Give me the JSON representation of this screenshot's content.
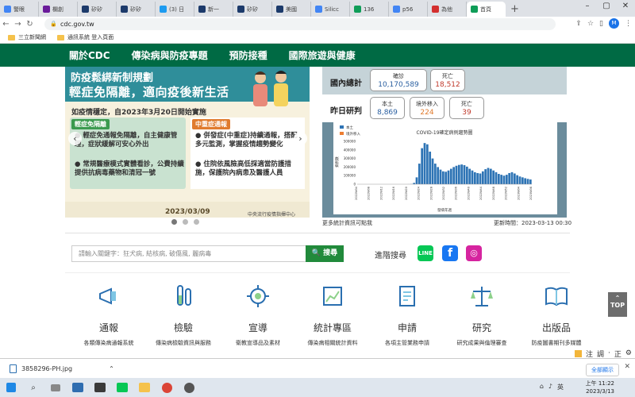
{
  "browser": {
    "tabs": [
      {
        "label": "警眼",
        "color": "#4285f4"
      },
      {
        "label": "欄創",
        "color": "#6a1b9a"
      },
      {
        "label": "矽矽",
        "color": "#1c3a6b"
      },
      {
        "label": "矽矽",
        "color": "#1c3a6b"
      },
      {
        "label": "(3) 日",
        "color": "#1d9bf0"
      },
      {
        "label": "新一",
        "color": "#1c3a6b"
      },
      {
        "label": "矽矽",
        "color": "#1c3a6b"
      },
      {
        "label": "美國",
        "color": "#1c3a6b"
      },
      {
        "label": "Silicc",
        "color": "#4285f4"
      },
      {
        "label": "136",
        "color": "#0f9d58"
      },
      {
        "label": "p56",
        "color": "#4285f4"
      },
      {
        "label": "為他",
        "color": "#d32f2f"
      },
      {
        "label": "首頁",
        "color": "#0f9d58"
      }
    ],
    "url": "cdc.gov.tw",
    "bookmarks": [
      "三立新聞網",
      "通訊系統 登入頁面"
    ],
    "avatar_letter": "M"
  },
  "nav": {
    "items": [
      "關於CDC",
      "傳染病與防疫專題",
      "預防接種",
      "國際旅遊與健康"
    ]
  },
  "banner": {
    "title1": "防疫鬆綁新制規劃",
    "title2": "輕症免隔離，適向疫後新生活",
    "subtitle": "如疫情穩定，自2023年3月20日開始實施",
    "left_header": "輕症免隔離",
    "left_items": [
      "輕症免通報免隔離，自主健康管理，症狀緩解可安心外出",
      "常規醫療模式實體看診，公費持續提供抗病毒藥物和清冠一號"
    ],
    "right_header": "中重症通報",
    "right_items": [
      "併發症(中重症)持續通報，搭配多元監測，掌握疫情趨勢變化",
      "住院依風險高低採適當防護措施，保護院內病患及醫護人員"
    ],
    "date": "2023/03/09",
    "org": "中央流行疫情指揮中心"
  },
  "stats": {
    "domestic_label": "國內總計",
    "yesterday_label": "昨日研判",
    "confirmed_label": "確診",
    "confirmed_value": "10,170,589",
    "death_label": "死亡",
    "death_value": "18,512",
    "local_label": "本土",
    "local_value": "8,869",
    "imported_label": "境外移入",
    "imported_value": "224",
    "daily_death_label": "死亡",
    "daily_death_value": "39",
    "more_note": "更多統計資訊可點我",
    "update_time": "更新時間：2023-03-13 00:30"
  },
  "chart_data": {
    "type": "bar",
    "title": "COVID-19確定病例趨勢圖",
    "legend": [
      "本土",
      "境外移入"
    ],
    "ylabel": "病例數",
    "xlabel": "發病年週",
    "ylim": [
      0,
      500000
    ],
    "yticks": [
      "500000",
      "400000",
      "300000",
      "200000",
      "100000",
      "0"
    ],
    "xticks": [
      "2022W04",
      "2022W08",
      "2022W12",
      "2022W16",
      "2022W20",
      "2022W24",
      "2022W28",
      "2022W32",
      "2022W36",
      "2022W40",
      "2022W44",
      "2022W48",
      "2022W52",
      "2023W04",
      "2023W08"
    ],
    "values": [
      0,
      0,
      0,
      0,
      0,
      0,
      0,
      0,
      0,
      0,
      0,
      0,
      0,
      0,
      0,
      0,
      0,
      0,
      0,
      500,
      2000,
      15000,
      80000,
      240000,
      420000,
      480000,
      465000,
      380000,
      300000,
      240000,
      200000,
      170000,
      150000,
      145000,
      160000,
      180000,
      200000,
      215000,
      225000,
      230000,
      222000,
      205000,
      180000,
      160000,
      140000,
      130000,
      125000,
      150000,
      175000,
      190000,
      180000,
      160000,
      140000,
      120000,
      110000,
      100000,
      110000,
      130000,
      140000,
      125000,
      105000,
      90000,
      80000,
      70000,
      62000,
      55000
    ],
    "colors": {
      "local": "#2e74b5",
      "imported": "#ed7d31"
    }
  },
  "search": {
    "placeholder": "請輸入關鍵字：狂犬病, 結核病, 破傷風, 麗病毒",
    "button": "搜尋",
    "advanced": "進階搜尋"
  },
  "icons": [
    {
      "title": "通報",
      "sub": "各類傳染病通報系統",
      "icon": "megaphone-icon"
    },
    {
      "title": "檢驗",
      "sub": "傳染病檢驗資訊與服務",
      "icon": "test-tube-icon"
    },
    {
      "title": "宣導",
      "sub": "衛教宣導品及素材",
      "icon": "microbe-icon"
    },
    {
      "title": "統計專區",
      "sub": "傳染病相關統計資料",
      "icon": "statistics-icon"
    },
    {
      "title": "申請",
      "sub": "各項主管業務申請",
      "icon": "application-icon"
    },
    {
      "title": "研究",
      "sub": "研究成果與倫理審查",
      "icon": "scale-icon"
    },
    {
      "title": "出版品",
      "sub": "防疫圖書期刊多媒體",
      "icon": "book-icon"
    }
  ],
  "top_button": "TOP",
  "download": {
    "file": "3858296-PH.jpg",
    "show_all": "全部顯示"
  },
  "ime": [
    "注",
    "調",
    "·",
    "正"
  ],
  "clock": {
    "time": "上午 11:22",
    "date": "2023/3/13"
  }
}
